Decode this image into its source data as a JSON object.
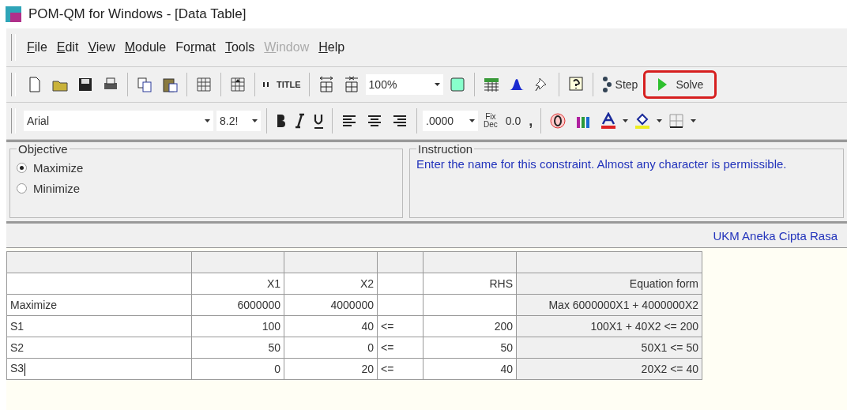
{
  "window": {
    "title": "POM-QM for Windows - [Data Table]"
  },
  "menu": [
    {
      "key": "F",
      "post": "ile",
      "disabled": false
    },
    {
      "key": "E",
      "post": "dit",
      "disabled": false
    },
    {
      "key": "V",
      "post": "iew",
      "disabled": false
    },
    {
      "key": "M",
      "post": "odule",
      "disabled": false
    },
    {
      "pre": "Fo",
      "key": "r",
      "post": "mat",
      "disabled": false
    },
    {
      "key": "T",
      "post": "ools",
      "disabled": false
    },
    {
      "key": "W",
      "post": "indow",
      "disabled": true
    },
    {
      "key": "H",
      "post": "elp",
      "disabled": false
    }
  ],
  "toolbar": {
    "zoom": "100%",
    "step": "Step",
    "solve": {
      "label": "Solve",
      "highlighted": true
    },
    "title_icon": "TITLE"
  },
  "format_bar": {
    "font": "Arial",
    "size": "8.2!",
    "decimals": ".0000",
    "fix": "Fix",
    "dec": "Dec",
    "zero": "0.0",
    "comma": ","
  },
  "objective": {
    "legend": "Objective",
    "options": [
      {
        "label": "Maximize",
        "selected": true
      },
      {
        "label": "Minimize",
        "selected": false
      }
    ]
  },
  "instruction": {
    "legend": "Instruction",
    "text": "Enter the name for this constraint. Almost any character is permissible."
  },
  "problem_title": "UKM Aneka Cipta Rasa",
  "table": {
    "columns": [
      {
        "kind": "name"
      },
      {
        "kind": "num",
        "label": "X1"
      },
      {
        "kind": "num",
        "label": "X2"
      },
      {
        "kind": "sign"
      },
      {
        "kind": "num",
        "label": "RHS"
      },
      {
        "kind": "eq",
        "label": "Equation form"
      }
    ],
    "rows": [
      {
        "cells": [
          "Maximize",
          "6000000",
          "4000000",
          "",
          "",
          "Max  6000000X1 + 4000000X2"
        ],
        "editing": false
      },
      {
        "cells": [
          "S1",
          "100",
          "40",
          "<=",
          "200",
          "100X1 +  40X2 <= 200"
        ],
        "editing": false
      },
      {
        "cells": [
          "S2",
          "50",
          "0",
          "<=",
          "50",
          "50X1 <= 50"
        ],
        "editing": false
      },
      {
        "cells": [
          "S3",
          "0",
          "20",
          "<=",
          "40",
          "20X2 <= 40"
        ],
        "editing": true
      }
    ]
  }
}
